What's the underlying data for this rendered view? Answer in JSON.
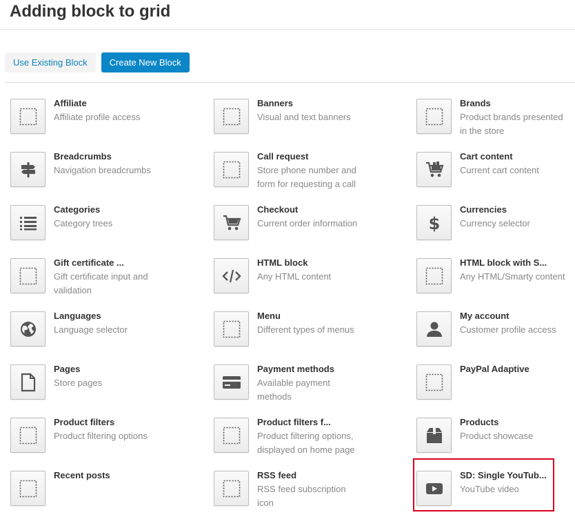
{
  "header": {
    "title": "Adding block to grid"
  },
  "tabs": [
    {
      "label": "Use Existing Block",
      "active": false
    },
    {
      "label": "Create New Block",
      "active": true
    }
  ],
  "accent_color": "#0b86c6",
  "highlight_color": "#d9001f",
  "blocks": [
    {
      "name": "Affiliate",
      "desc": "Affiliate profile access",
      "icon": "dotted-square-icon"
    },
    {
      "name": "Banners",
      "desc": "Visual and text banners",
      "icon": "dotted-square-icon"
    },
    {
      "name": "Brands",
      "desc": "Product brands presented in the store",
      "icon": "dotted-square-icon"
    },
    {
      "name": "Breadcrumbs",
      "desc": "Navigation breadcrumbs",
      "icon": "signpost-icon"
    },
    {
      "name": "Call request",
      "desc": "Store phone number and form for requesting a call",
      "icon": "dotted-square-icon"
    },
    {
      "name": "Cart content",
      "desc": "Current cart content",
      "icon": "cart-full-icon"
    },
    {
      "name": "Categories",
      "desc": "Category trees",
      "icon": "list-icon"
    },
    {
      "name": "Checkout",
      "desc": "Current order information",
      "icon": "cart-icon"
    },
    {
      "name": "Currencies",
      "desc": "Currency selector",
      "icon": "dollar-icon"
    },
    {
      "name": "Gift certificate ...",
      "desc": "Gift certificate input and validation",
      "icon": "dotted-square-icon"
    },
    {
      "name": "HTML block",
      "desc": "Any HTML content",
      "icon": "code-icon"
    },
    {
      "name": "HTML block with S...",
      "desc": "Any HTML/Smarty content",
      "icon": "dotted-square-icon"
    },
    {
      "name": "Languages",
      "desc": "Language selector",
      "icon": "globe-icon"
    },
    {
      "name": "Menu",
      "desc": "Different types of menus",
      "icon": "dotted-square-icon"
    },
    {
      "name": "My account",
      "desc": "Customer profile access",
      "icon": "user-icon"
    },
    {
      "name": "Pages",
      "desc": "Store pages",
      "icon": "page-icon"
    },
    {
      "name": "Payment methods",
      "desc": "Available payment methods",
      "icon": "credit-card-icon"
    },
    {
      "name": "PayPal Adaptive",
      "desc": "",
      "icon": "dotted-square-icon"
    },
    {
      "name": "Product filters",
      "desc": "Product filtering options",
      "icon": "dotted-square-icon"
    },
    {
      "name": "Product filters f...",
      "desc": "Product filtering options, displayed on home page",
      "icon": "dotted-square-icon"
    },
    {
      "name": "Products",
      "desc": "Product showcase",
      "icon": "box-icon"
    },
    {
      "name": "Recent posts",
      "desc": "",
      "icon": "dotted-square-icon"
    },
    {
      "name": "RSS feed",
      "desc": "RSS feed subscription icon",
      "icon": "dotted-square-icon"
    },
    {
      "name": "SD: Single YouTub...",
      "desc": "YouTube video",
      "icon": "youtube-icon",
      "highlighted": true
    }
  ]
}
